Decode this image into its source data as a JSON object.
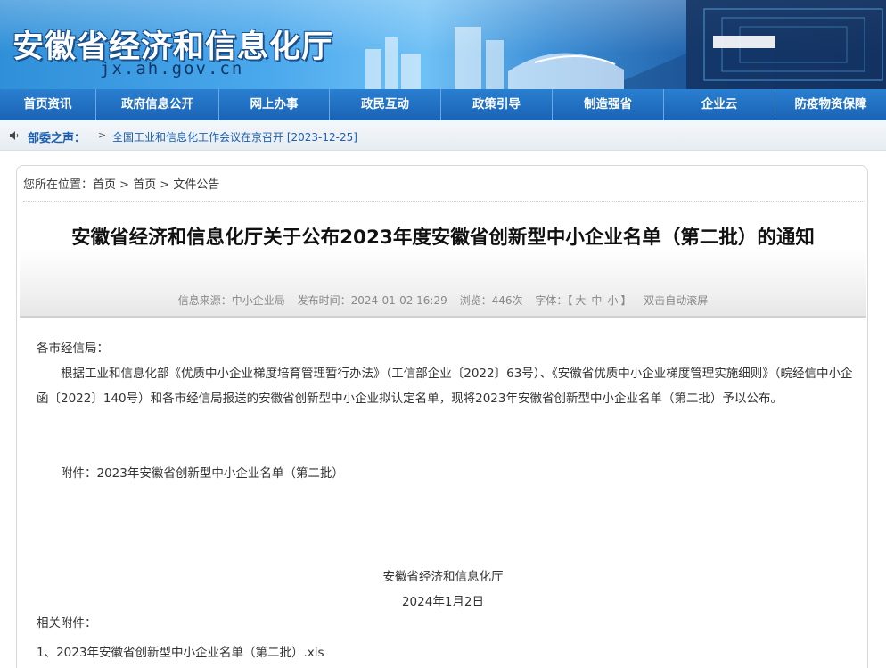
{
  "header": {
    "site_title": "安徽省经济和信息化厅",
    "site_domain": "jx.ah.gov.cn"
  },
  "nav": {
    "items": [
      "首页资讯",
      "政府信息公开",
      "网上办事",
      "政民互动",
      "政策引导",
      "制造强省",
      "企业云",
      "防疫物资保障"
    ]
  },
  "notice": {
    "label": "部委之声：",
    "arrow": ">",
    "text": "全国工业和信息化工作会议在京召开 [2023-12-25]"
  },
  "breadcrumb": {
    "prefix": "您所在位置：",
    "items": [
      "首页",
      "首页",
      "文件公告"
    ],
    "sep": ">"
  },
  "article": {
    "title": "安徽省经济和信息化厅关于公布2023年度安徽省创新型中小企业名单（第二批）的通知",
    "meta": {
      "source": "信息来源：中小企业局",
      "published": "发布时间：2024-01-02 16:29",
      "views": "浏览：446次",
      "font_label": "字体：【",
      "font_large": "大",
      "font_medium": "中",
      "font_small": "小",
      "font_close": "】",
      "autoscroll": "双击自动滚屏"
    },
    "salutation": "各市经信局：",
    "paragraph": "根据工业和信息化部《优质中小企业梯度培育管理暂行办法》（工信部企业〔2022〕63号）、《安徽省优质中小企业梯度管理实施细则》（皖经信中小企函〔2022〕140号）和各市经信局报送的安徽省创新型中小企业拟认定名单，现将2023年安徽省创新型中小企业名单（第二批）予以公布。",
    "attachment_line": "附件：2023年安徽省创新型中小企业名单（第二批）",
    "signature": "安徽省经济和信息化厅",
    "date": "2024年1月2日",
    "related_label": "相关附件：",
    "related_files": [
      "1、2023年安徽省创新型中小企业名单（第二批）.xls"
    ]
  },
  "colors": {
    "nav_bg": "#1a63b5",
    "link_blue": "#1a5fb0",
    "title_text": "#111111"
  }
}
